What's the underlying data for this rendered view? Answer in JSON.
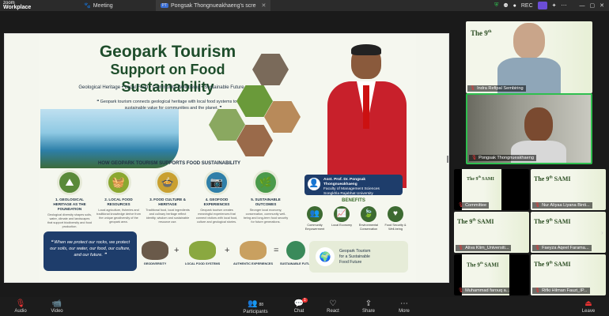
{
  "app": {
    "logo_line1": "zoom",
    "logo_line2": "Workplace"
  },
  "tabs": [
    {
      "label": "Meeting",
      "icon": "paw-icon"
    },
    {
      "label": "Pongsak  Thongnueakhaeng's scre",
      "icon": "screen-share-icon"
    }
  ],
  "topbar_right": {
    "rec": "REC"
  },
  "slide": {
    "title_line1": "Geopark Tourism",
    "title_line2": "Support on Food Sustainability",
    "subtitle": "Geological Heritage • Local Food • Community Well-being • Sustainable Future",
    "quote": "❝ Geopark tourism connects geological heritage with local food systems to create sustainable value for communities and the planet. ❞",
    "section_title": "HOW GEOPARK TOURISM SUPPORTS FOOD SUSTAINABILITY",
    "steps": [
      {
        "title": "1. GEOLOGICAL HERITAGE AS THE FOUNDATION",
        "desc": "Geological diversity shapes soils, water, climate and landscapes that support biodiversity and food production."
      },
      {
        "title": "2. LOCAL FOOD RESOURCES",
        "desc": "Local agriculture, fisheries and traditional knowledge derive from the unique geodiversity of the geopark area."
      },
      {
        "title": "3. FOOD CULTURE & HERITAGE",
        "desc": "Traditional food, local ingredients and culinary heritage reflect identity, wisdom and sustainable resource use."
      },
      {
        "title": "4. GEOFOOD EXPERIENCES",
        "desc": "Geopark tourism creates meaningful experiences that connect visitors with local food, culture and geological stories."
      },
      {
        "title": "5. SUSTAINABLE OUTCOMES",
        "desc": "Stronger local economy, conservation, community well-being and long-term food security for future generations."
      }
    ],
    "speaker": {
      "name": "Asst. Prof. Dr. Pongsak Thongnueakhaeng",
      "faculty": "Faculty of Management Sciences",
      "university": "Songkhla Rajabhat University"
    },
    "benefits_title": "BENEFITS",
    "benefits": [
      {
        "label": "Community Empowerment"
      },
      {
        "label": "Local Economy"
      },
      {
        "label": "Environmental Conservation"
      },
      {
        "label": "Food Security & Well-being"
      }
    ],
    "bottom_quote": "❝ When we protect our rocks, we protect our soils, our water, our food, our culture, and our future. ❞",
    "formula": [
      {
        "label": "GEODIVERSITY"
      },
      {
        "label": "LOCAL FOOD SYSTEMS"
      },
      {
        "label": "AUTHENTIC EXPERIENCES"
      },
      {
        "label": "SUSTAINABLE FUTURE"
      }
    ],
    "formula_ops": [
      "+",
      "+",
      "="
    ],
    "geobox_line1": "Geopark Tourism",
    "geobox_line2": "for a Sustainable",
    "geobox_line3": "Food Future"
  },
  "participants": [
    {
      "name": "Indra Refipal Sembiring"
    },
    {
      "name": "Pongsak  Thongnueakhaeng"
    },
    {
      "name": "Committee"
    },
    {
      "name": "Nur Aliyaa Liyana Binti..."
    },
    {
      "name": "Aliva Klim_Universiti..."
    },
    {
      "name": "Faeyza Aqeel Farama..."
    },
    {
      "name": "Muhammad farouq a..."
    },
    {
      "name": "Rifki Hilman Fauzi_IP..."
    }
  ],
  "sami": {
    "prefix": "The",
    "num": "9",
    "sup": "th",
    "word": "SAMI"
  },
  "bottombar": {
    "audio": "Audio",
    "video": "Video",
    "participants": "Participants",
    "participants_count": "88",
    "chat": "Chat",
    "chat_badge": "1",
    "react": "React",
    "share": "Share",
    "more": "More",
    "leave": "Leave"
  }
}
